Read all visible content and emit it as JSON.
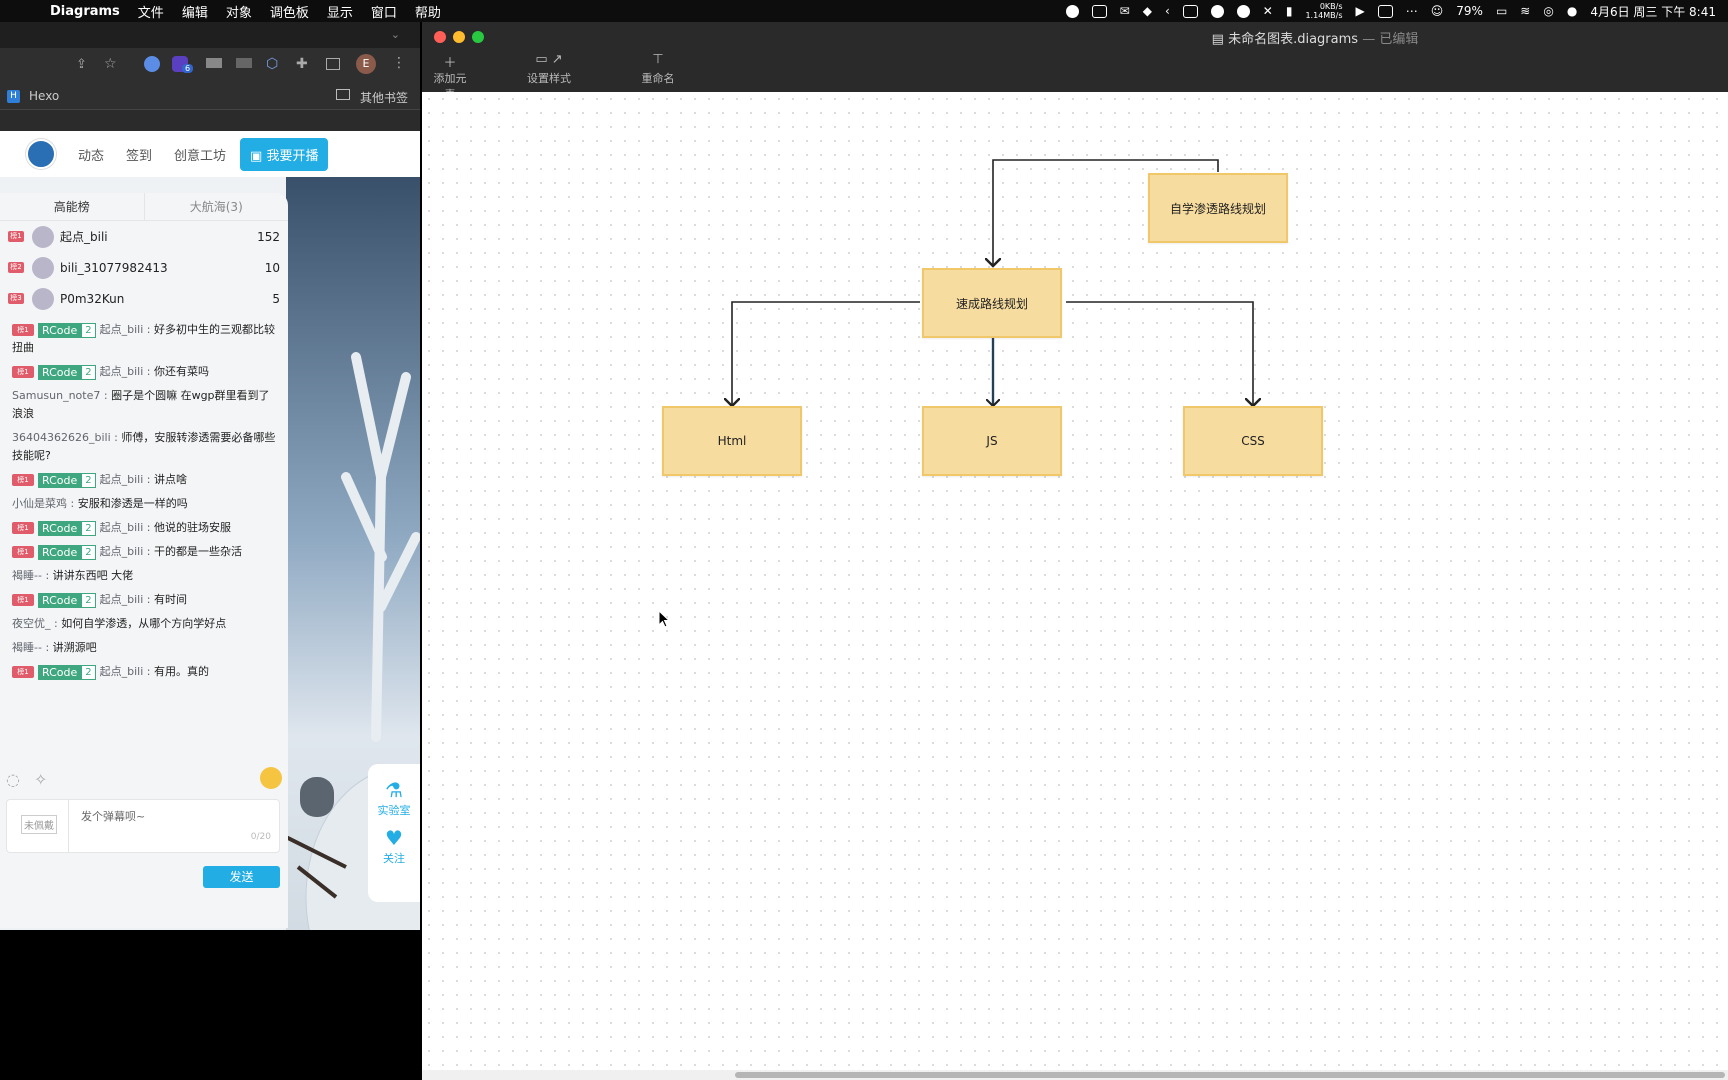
{
  "menubar": {
    "app": "Diagrams",
    "items": [
      "文件",
      "编辑",
      "对象",
      "调色板",
      "显示",
      "窗口",
      "帮助"
    ],
    "net_up": "0KB/s",
    "net_down": "1.14MB/s",
    "battery": "79%",
    "clock": "4月6日 周三 下午 8:41"
  },
  "browser": {
    "bookmark_hexo": "Hexo",
    "bookmark_other": "其他书签",
    "profile_initial": "E",
    "ext_badge_count": "6",
    "nav": {
      "dynamic": "动态",
      "checkin": "签到",
      "workshop": "创意工坊",
      "live_button": "我要开播"
    },
    "rank_tabs": {
      "high": "高能榜",
      "fleet": "大航海(3)"
    },
    "ranks": [
      {
        "badge": "榜1",
        "name": "起点_bili",
        "score": "152"
      },
      {
        "badge": "榜2",
        "name": "bili_31077982413",
        "score": "10"
      },
      {
        "badge": "榜3",
        "name": "P0m32Kun",
        "score": "5"
      }
    ],
    "chat": [
      {
        "medal": true,
        "user": "起点_bili",
        "text": "好多初中生的三观都比较扭曲"
      },
      {
        "medal": true,
        "user": "起点_bili",
        "text": "你还有菜吗"
      },
      {
        "medal": false,
        "user": "Samusun_note7",
        "text": "圈子是个圆嘛 在wgp群里看到了浪浪"
      },
      {
        "medal": false,
        "user": "36404362626_bili",
        "text": "师傅，安服转渗透需要必备哪些技能呢?"
      },
      {
        "medal": true,
        "user": "起点_bili",
        "text": "讲点啥"
      },
      {
        "medal": false,
        "user": "小仙是菜鸡",
        "text": "安服和渗透是一样的吗"
      },
      {
        "medal": true,
        "user": "起点_bili",
        "text": "他说的驻场安服"
      },
      {
        "medal": true,
        "user": "起点_bili",
        "text": "干的都是一些杂活"
      },
      {
        "medal": false,
        "user": "褐睡--",
        "text": "讲讲东西吧 大佬"
      },
      {
        "medal": true,
        "user": "起点_bili",
        "text": "有时间"
      },
      {
        "medal": false,
        "user": "夜空优_",
        "text": "如何自学渗透，从哪个方向学好点"
      },
      {
        "medal": false,
        "user": "褐睡--",
        "text": "讲溯源吧"
      },
      {
        "medal": true,
        "user": "起点_bili",
        "text": "有用。真的"
      }
    ],
    "medal_badge": "榜1",
    "medal_name": "RCode",
    "medal_level": "2",
    "unworn_label": "未佩戴",
    "danmaku_placeholder": "发个弹幕呗~",
    "char_count": "0/20",
    "send_label": "发送",
    "lab_label": "实验室",
    "follow_label": "关注"
  },
  "diagram_window": {
    "title": "未命名图表.diagrams",
    "status": "— 已编辑",
    "toolbar": {
      "add": "添加元素",
      "style": "设置样式",
      "rename": "重命名"
    },
    "nodes": {
      "top": "自学渗透路线规划",
      "middle": "速成路线规划",
      "left": "Html",
      "center": "JS",
      "right": "CSS"
    }
  },
  "colors": {
    "node_fill": "#f7dc9f",
    "node_border": "#f0c86a",
    "bili_blue": "#23ade5",
    "medal_green": "#3ea77f"
  }
}
